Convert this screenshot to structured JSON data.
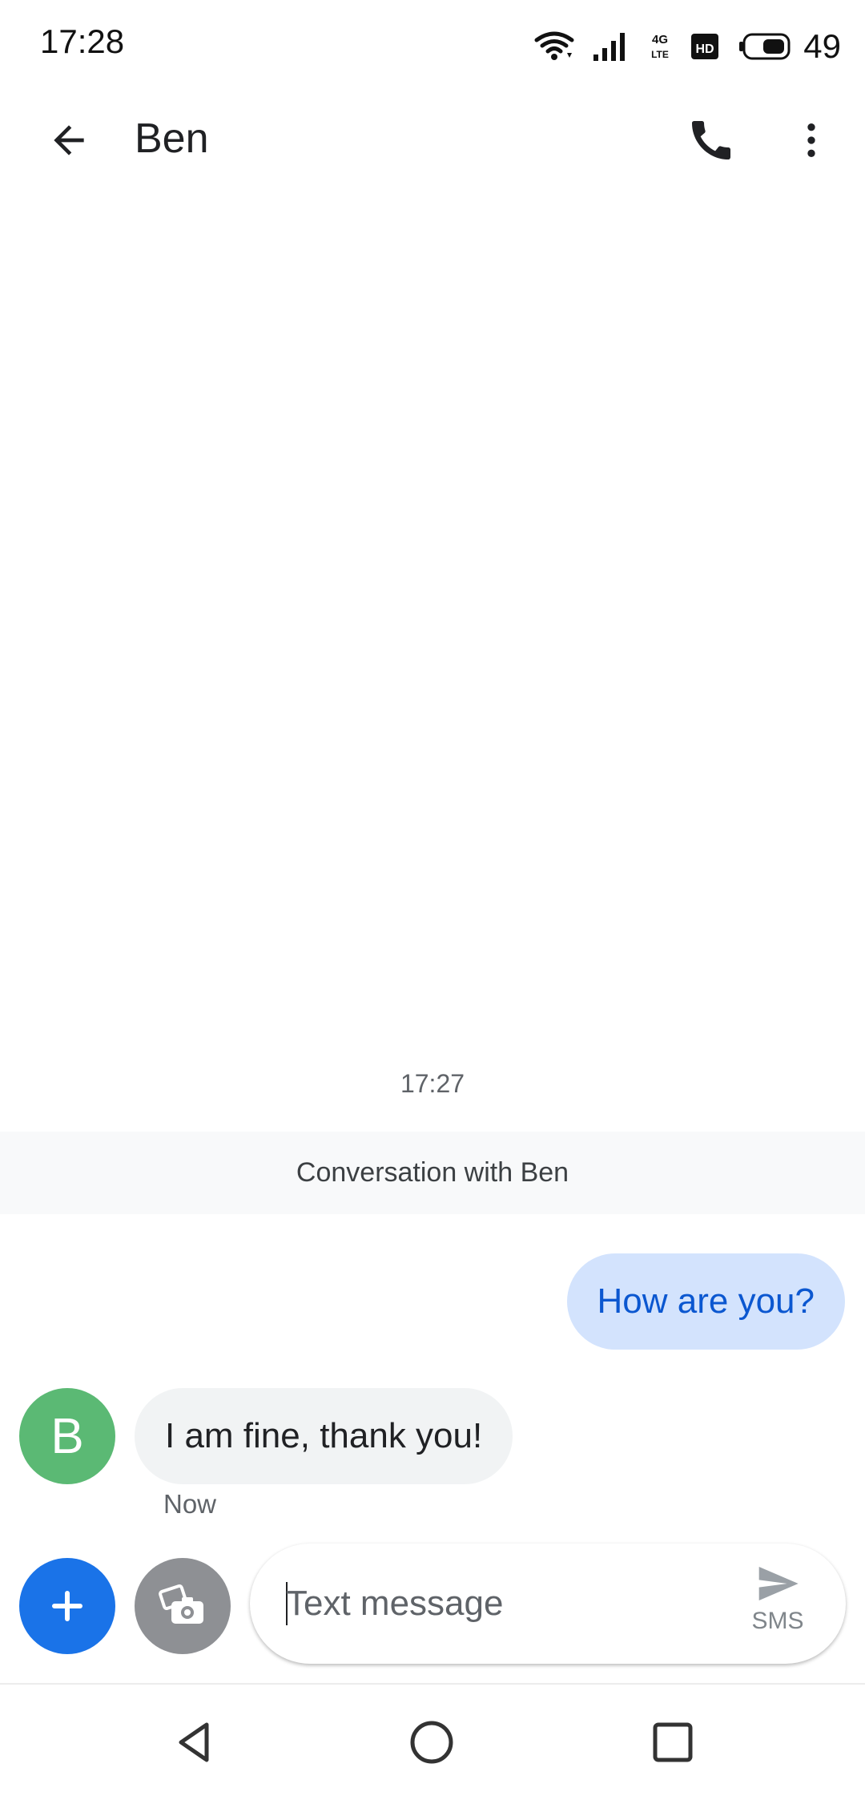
{
  "status_bar": {
    "time": "17:28",
    "network": "4G LTE",
    "battery": "49",
    "icons": [
      "wifi-icon",
      "signal-icon",
      "lte-icon",
      "hd-icon",
      "battery-icon"
    ]
  },
  "app_bar": {
    "title": "Ben",
    "icons": {
      "back": "arrow-back-icon",
      "call": "phone-icon",
      "more": "more-vert-icon"
    }
  },
  "conversation": {
    "timestamp": "17:27",
    "banner": "Conversation with Ben",
    "messages": [
      {
        "direction": "outgoing",
        "text": "How are you?"
      },
      {
        "direction": "incoming",
        "sender_initial": "B",
        "text": "I am fine, thank you!",
        "status": "Now"
      }
    ]
  },
  "compose": {
    "placeholder": "Text message",
    "value": "",
    "send_label": "SMS",
    "icons": {
      "add": "plus-icon",
      "gallery": "camera-gallery-icon",
      "send": "send-icon"
    }
  },
  "nav_bar": {
    "icons": [
      "nav-back-icon",
      "nav-home-icon",
      "nav-recents-icon"
    ]
  },
  "colors": {
    "accent": "#1a73e8",
    "outgoing_bubble": "#d3e3fd",
    "outgoing_text": "#0b57d0",
    "incoming_bubble": "#f1f3f4",
    "avatar": "#5bb974"
  }
}
